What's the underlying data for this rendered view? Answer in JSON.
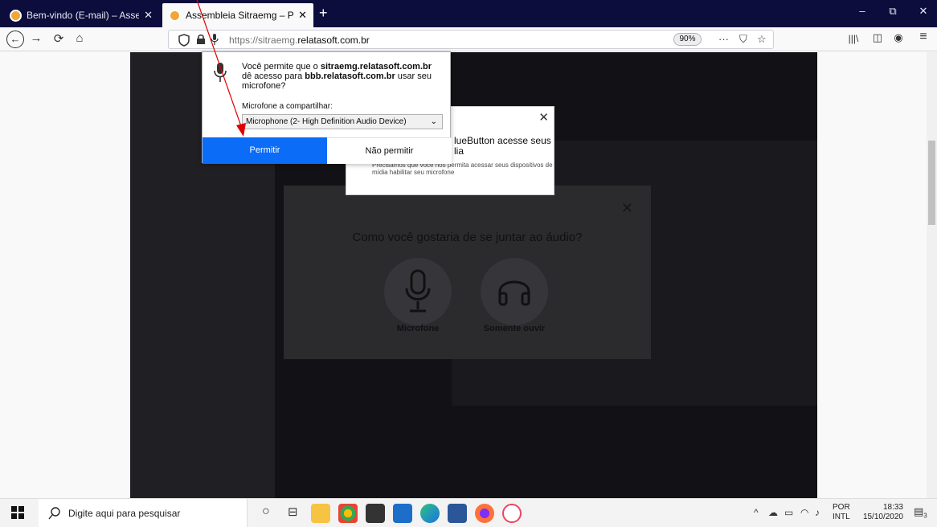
{
  "tabs": [
    {
      "title": "Bem-vindo (E-mail) – Assembléia Sitraemg",
      "close": "✕"
    },
    {
      "title": "Assembleia Sitraemg – Powered by BigBlueButton",
      "close": "✕"
    }
  ],
  "new_tab": "+",
  "window": {
    "minimize": "–",
    "maximize": "⧉",
    "close": "✕"
  },
  "nav": {
    "back": "←",
    "forward": "→",
    "reload": "⟳",
    "home": "⌂",
    "url_prefix": "https://sitraemg.",
    "url_domain": "relatasoft.com.br",
    "zoom": "90%",
    "more": "···",
    "pocket": "⛉",
    "bookmark": "☆",
    "library": "|||\\",
    "sidebar": "◫",
    "account": "◉",
    "menu": "≡"
  },
  "permission_popup": {
    "message_pre": "Você permite que o ",
    "site": "sitraemg.relatasoft.com.br",
    "message_mid": " dê acesso para ",
    "embedded_site": "bbb.relatasoft.com.br",
    "message_post": " usar seu microfone?",
    "share_label": "Microfone a compartilhar:",
    "selected_device": "Microphone (2- High Definition Audio Device)",
    "allow_label": "Permitir",
    "deny_label": "Não permitir"
  },
  "bbb_notice": {
    "title_line1": "lueButton acesse seus",
    "title_line2": "lia",
    "body": "Precisamos que você nos permita acessar seus dispositivos de mídia habilitar seu microfone",
    "close": "✕"
  },
  "audio_modal": {
    "title": "Como você gostaria de se juntar ao áudio?",
    "close": "✕",
    "options": [
      "Microfone",
      "Somente ouvir"
    ]
  },
  "taskbar": {
    "search_placeholder": "Digite aqui para pesquisar",
    "lang_line1": "POR",
    "lang_line2": "INTL",
    "time": "18:33",
    "date": "15/10/2020",
    "notif_count": "3"
  },
  "colors": {
    "tabbar": "#0c0c3d",
    "allow_button": "#0a6cf7",
    "annotation": "#e00000"
  }
}
